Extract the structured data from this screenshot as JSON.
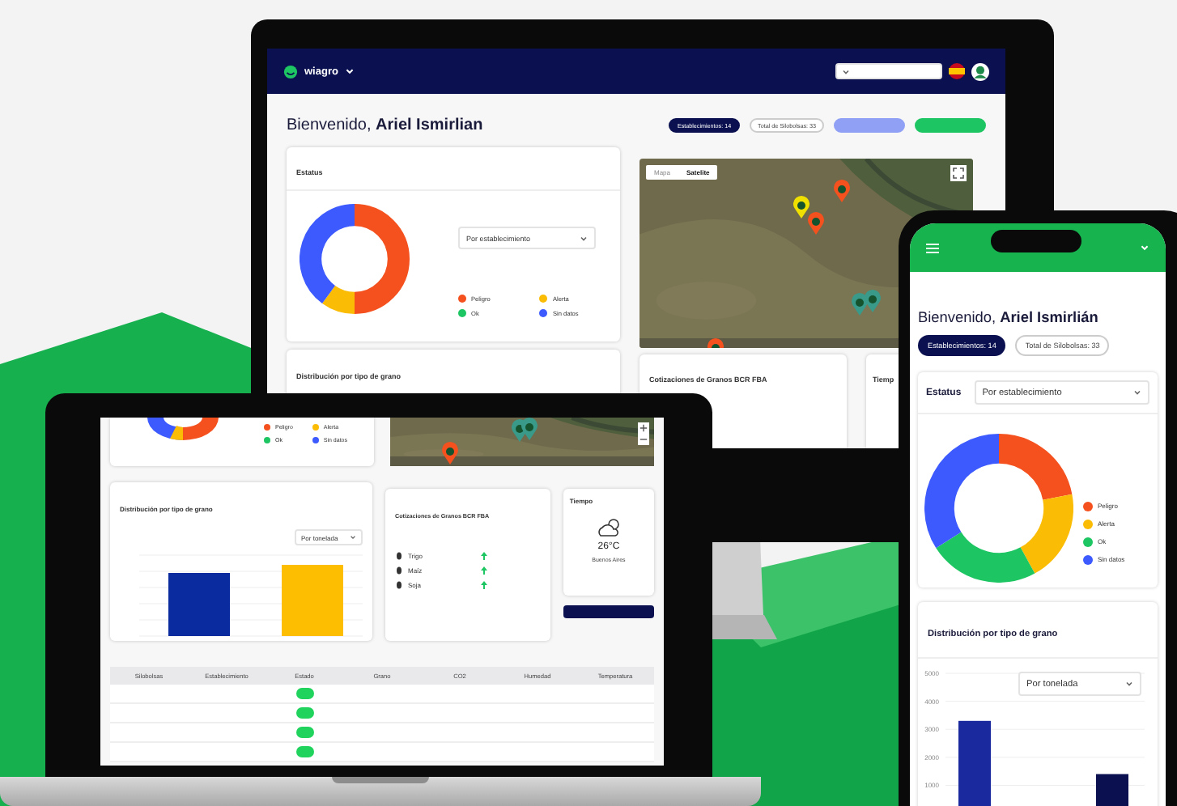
{
  "monitor": {
    "brand": "wiagro",
    "greeting": "Bienvenido, **Ariel Ismirlian**",
    "pills": [
      {
        "label": "Establecimientos: 14",
        "kind": "dark"
      },
      {
        "label": "Total de Silobolsas: 33",
        "kind": "outline"
      },
      {
        "kind": "lavender"
      },
      {
        "kind": "green"
      }
    ],
    "status_card": {
      "title": "Estatus",
      "select": "Por establecimiento",
      "legend": [
        {
          "label": "Peligro",
          "color": "#f4511e"
        },
        {
          "label": "Alerta",
          "color": "#fbbc05"
        },
        {
          "label": "Ok",
          "color": "#1ec663"
        },
        {
          "label": "Sin datos",
          "color": "#3d5afe"
        }
      ]
    },
    "map_tabs": [
      {
        "label": "Mapa",
        "selected": false
      },
      {
        "label": "Satelite",
        "selected": true
      }
    ],
    "grain_card": {
      "title": "Distribución por tipo de grano"
    },
    "quotes_card": {
      "title": "Cotizaciones de Granos BCR FBA"
    },
    "weather_card": {
      "title": "Tiemp"
    }
  },
  "laptop": {
    "legend": [
      {
        "label": "Peligro",
        "color": "#f4511e"
      },
      {
        "label": "Alerta",
        "color": "#fbbc05"
      },
      {
        "label": "Ok",
        "color": "#1ec663"
      },
      {
        "label": "Sin datos",
        "color": "#3d5afe"
      }
    ],
    "grain_card": {
      "title": "Distribución por tipo de grano",
      "select": "Por tonelada"
    },
    "quotes_card": {
      "title": "Cotizaciones de Granos BCR FBA",
      "rows": [
        {
          "grain": "Trigo"
        },
        {
          "grain": "Maíz"
        },
        {
          "grain": "Soja"
        }
      ]
    },
    "weather_card": {
      "title": "Tiempo",
      "temperature": "26°C",
      "city": "Buenos Aires"
    },
    "table": {
      "columns": [
        "Silobolsas",
        "Establecimiento",
        "Estado",
        "Grano",
        "CO2",
        "Humedad",
        "Temperatura"
      ],
      "rows": [
        {
          "color": "#1fd35c"
        },
        {
          "color": "#1fd35c"
        },
        {
          "color": "#1fd35c"
        },
        {
          "color": "#1fd35c"
        }
      ]
    }
  },
  "phone": {
    "greeting": "Bienvenido, **Ariel Ismirlián**",
    "pills": [
      {
        "label": "Establecimientos: 14",
        "selected": true
      },
      {
        "label": "Total de Silobolsas: 33",
        "selected": false
      }
    ],
    "status_card": {
      "title": "Estatus",
      "select": "Por establecimiento",
      "legend": [
        {
          "label": "Peligro",
          "color": "#f4511e"
        },
        {
          "label": "Alerta",
          "color": "#fbbc05"
        },
        {
          "label": "Ok",
          "color": "#1ec663"
        },
        {
          "label": "Sin datos",
          "color": "#3d5afe"
        }
      ]
    },
    "grain_card": {
      "title": "Distribución por tipo de grano",
      "select": "Por tonelada",
      "chart_data": {
        "type": "bar",
        "values": [
          3300,
          1400
        ],
        "ylim": [
          0,
          5000
        ],
        "yticks": [
          1000,
          2000,
          3000,
          4000,
          5000
        ],
        "grid": true
      }
    }
  }
}
